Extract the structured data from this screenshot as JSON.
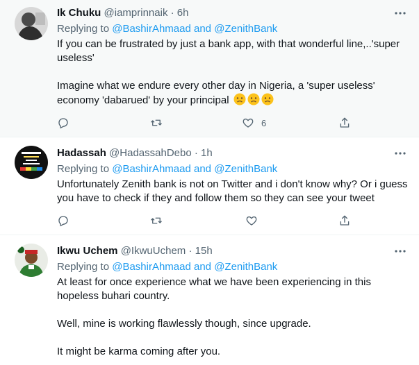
{
  "tweets": [
    {
      "name": "Ik Chuku",
      "handle": "@iamprinnaik",
      "dot": "·",
      "time": "6h",
      "replying_prefix": "Replying to",
      "replying_users": "@BashirAhmaad and @ZenithBank",
      "text_lines": [
        "If you can be frustrated by just a bank app, with that wonderful line,..'super useless'",
        "Imagine what we endure every other day in Nigeria, a 'super useless' economy 'dabarued' by your principal"
      ],
      "emoji": "frowning-face",
      "like_count": "6"
    },
    {
      "name": "Hadassah",
      "handle": "@HadassahDebo",
      "dot": "·",
      "time": "1h",
      "replying_prefix": "Replying to",
      "replying_users": "@BashirAhmaad and @ZenithBank",
      "text_lines": [
        "Unfortunately Zenith bank is not on Twitter and i don't know why? Or i guess you have to check if they  and follow them so they can see your tweet"
      ]
    },
    {
      "name": "Ikwu Uchem",
      "handle": "@IkwuUchem",
      "dot": "·",
      "time": "15h",
      "replying_prefix": "Replying to",
      "replying_users": "@BashirAhmaad and @ZenithBank",
      "text_lines": [
        "At least for once experience what we have been experiencing in this hopeless buhari country.",
        "Well, mine is working flawlessly though, since upgrade.",
        "It might be karma coming after you."
      ]
    }
  ],
  "icons": {
    "more": "more-icon",
    "reply": "reply-icon",
    "retweet": "retweet-icon",
    "like": "heart-icon",
    "share": "share-icon"
  },
  "colors": {
    "link": "#1d9bf0",
    "secondary": "#536471",
    "highlight_bg": "#f7f9f9"
  }
}
